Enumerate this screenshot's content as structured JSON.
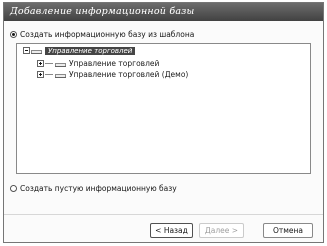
{
  "window": {
    "title": "Добавление информационной базы"
  },
  "options": {
    "create_from_template": {
      "label": "Создать информационную базу из шаблона",
      "selected": true
    },
    "create_empty": {
      "label": "Создать пустую информационную базу",
      "selected": false
    }
  },
  "tree": {
    "root": {
      "label": "Управление торговлей",
      "expanded": true,
      "selected": true
    },
    "children": [
      {
        "label": "Управление торговлей",
        "expanded": false
      },
      {
        "label": "Управление торговлей (Демо)",
        "expanded": false
      }
    ]
  },
  "buttons": {
    "back": "< Назад",
    "next": "Далее >",
    "cancel": "Отмена"
  }
}
